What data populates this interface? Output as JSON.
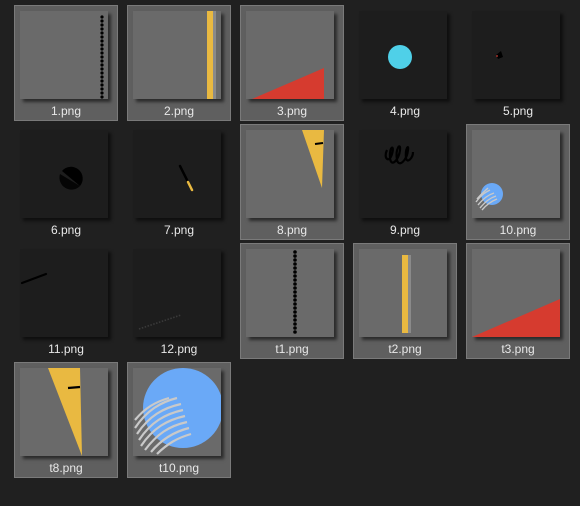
{
  "files": [
    {
      "name": "1.png",
      "selected": true,
      "bg": "light",
      "icon": "dotted-vertical-line-icon"
    },
    {
      "name": "2.png",
      "selected": true,
      "bg": "light",
      "icon": "yellow-vertical-bar-icon"
    },
    {
      "name": "3.png",
      "selected": true,
      "bg": "light",
      "icon": "red-triangle-icon"
    },
    {
      "name": "4.png",
      "selected": false,
      "bg": "dark",
      "icon": "cyan-circle-icon"
    },
    {
      "name": "5.png",
      "selected": false,
      "bg": "dark",
      "icon": "small-dark-shape-icon"
    },
    {
      "name": "6.png",
      "selected": false,
      "bg": "dark",
      "icon": "black-half-circle-icon"
    },
    {
      "name": "7.png",
      "selected": false,
      "bg": "dark",
      "icon": "diagonal-stick-icon"
    },
    {
      "name": "8.png",
      "selected": true,
      "bg": "light",
      "icon": "yellow-wedge-icon"
    },
    {
      "name": "9.png",
      "selected": false,
      "bg": "dark",
      "icon": "scribble-loops-icon"
    },
    {
      "name": "10.png",
      "selected": true,
      "bg": "light",
      "icon": "blue-circle-scribble-icon"
    },
    {
      "name": "11.png",
      "selected": false,
      "bg": "dark",
      "icon": "diagonal-line-icon"
    },
    {
      "name": "12.png",
      "selected": false,
      "bg": "dark",
      "icon": "faint-dotted-line-icon"
    },
    {
      "name": "t1.png",
      "selected": true,
      "bg": "light",
      "icon": "dotted-vertical-line-icon"
    },
    {
      "name": "t2.png",
      "selected": true,
      "bg": "light",
      "icon": "yellow-vertical-bar-icon"
    },
    {
      "name": "t3.png",
      "selected": true,
      "bg": "light",
      "icon": "red-triangle-icon"
    },
    {
      "name": "t8.png",
      "selected": true,
      "bg": "light",
      "icon": "yellow-wedge-icon"
    },
    {
      "name": "t10.png",
      "selected": true,
      "bg": "light",
      "icon": "blue-circle-scribble-icon"
    }
  ],
  "colors": {
    "background": "#202020",
    "selection": "#5f5f5f",
    "yellow": "#e9b941",
    "red": "#d63b2f",
    "cyan": "#4fd0e8",
    "blue": "#6aa9f7",
    "scribble": "#c9c9c9"
  }
}
